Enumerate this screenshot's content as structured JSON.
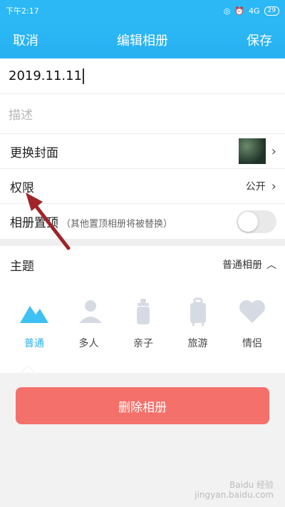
{
  "status": {
    "time": "下午2:17",
    "network": "4G",
    "battery": "29"
  },
  "nav": {
    "cancel": "取消",
    "title": "编辑相册",
    "save": "保存"
  },
  "album": {
    "name": "2019.11.11",
    "description_placeholder": "描述"
  },
  "rows": {
    "cover": {
      "label": "更换封面"
    },
    "permission": {
      "label": "权限",
      "value": "公开"
    },
    "pin": {
      "label": "相册置顶",
      "hint": "（其他置顶相册将被替换）",
      "enabled": false
    }
  },
  "theme": {
    "label": "主题",
    "selected": "普通相册",
    "options": [
      {
        "label": "普通",
        "icon": "mountain-icon",
        "active": true
      },
      {
        "label": "多人",
        "icon": "people-icon",
        "active": false
      },
      {
        "label": "亲子",
        "icon": "baby-bottle-icon",
        "active": false
      },
      {
        "label": "旅游",
        "icon": "luggage-icon",
        "active": false
      },
      {
        "label": "情侣",
        "icon": "heart-icon",
        "active": false
      }
    ]
  },
  "delete_label": "删除相册",
  "watermark": {
    "line1": "Baidu 经验",
    "line2": "jingyan.baidu.com"
  },
  "colors": {
    "accent": "#29b1f0",
    "delete": "#f4706a",
    "arrow": "#a0242a"
  }
}
